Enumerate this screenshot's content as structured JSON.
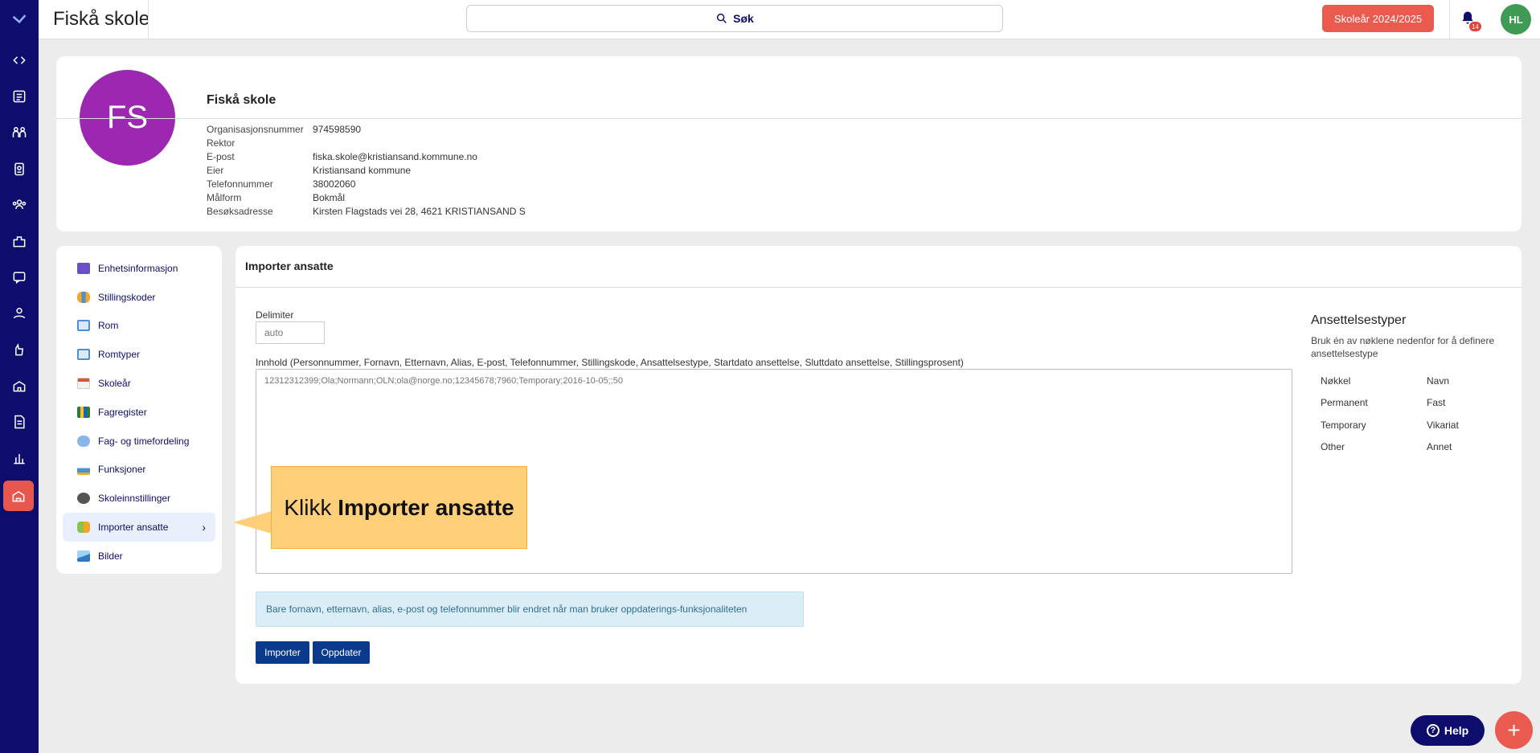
{
  "topbar": {
    "title": "Fiskå skole",
    "search_label": "Søk",
    "school_year": "Skoleår 2024/2025",
    "notification_count": "14",
    "user_initials": "HL"
  },
  "school": {
    "initials": "FS",
    "name": "Fiskå skole",
    "info": [
      {
        "label": "Organisasjonsnummer",
        "value": "974598590"
      },
      {
        "label": "Rektor",
        "value": ""
      },
      {
        "label": "E-post",
        "value": "fiska.skole@kristiansand.kommune.no"
      },
      {
        "label": "Eier",
        "value": "Kristiansand kommune"
      },
      {
        "label": "Telefonnummer",
        "value": "38002060"
      },
      {
        "label": "Målform",
        "value": "Bokmål"
      },
      {
        "label": "Besøksadresse",
        "value": "Kirsten Flagstads vei 28, 4621 KRISTIANSAND S"
      }
    ]
  },
  "menu": [
    {
      "label": "Enhetsinformasjon",
      "icon": "id-card-icon"
    },
    {
      "label": "Stillingskoder",
      "icon": "people-icon"
    },
    {
      "label": "Rom",
      "icon": "floorplan-icon"
    },
    {
      "label": "Romtyper",
      "icon": "floorplan-icon"
    },
    {
      "label": "Skoleår",
      "icon": "calendar-icon"
    },
    {
      "label": "Fagregister",
      "icon": "books-icon"
    },
    {
      "label": "Fag- og timefordeling",
      "icon": "schedule-icon"
    },
    {
      "label": "Funksjoner",
      "icon": "function-icon"
    },
    {
      "label": "Skoleinnstillinger",
      "icon": "gear-icon"
    },
    {
      "label": "Importer ansatte",
      "icon": "import-users-icon"
    },
    {
      "label": "Bilder",
      "icon": "image-icon"
    }
  ],
  "panel": {
    "title": "Importer ansatte",
    "delimiter_label": "Delimiter",
    "delimiter_placeholder": "auto",
    "content_label": "Innhold (Personnummer, Fornavn, Etternavn, Alias, E-post, Telefonnummer, Stillingskode, Ansattelsestype, Startdato ansettelse, Sluttdato ansettelse, Stillingsprosent)",
    "content_placeholder": "12312312399;Ola;Normann;OLN;ola@norge.no;12345678;7960;Temporary;2016-10-05;;50",
    "notice": "Bare fornavn, etternavn, alias, e-post og telefonnummer blir endret når man bruker oppdaterings-funksjonaliteten",
    "import_button": "Importer",
    "update_button": "Oppdater"
  },
  "types": {
    "title": "Ansettelsestyper",
    "description": "Bruk én av nøklene nedenfor for å definere ansettelsestype",
    "header_key": "Nøkkel",
    "header_name": "Navn",
    "rows": [
      {
        "key": "Permanent",
        "name": "Fast"
      },
      {
        "key": "Temporary",
        "name": "Vikariat"
      },
      {
        "key": "Other",
        "name": "Annet"
      }
    ]
  },
  "callout": {
    "prefix": "Klikk",
    "bold": "Importer ansatte"
  },
  "help_label": "Help",
  "colors": {
    "rail": "#0d0d6b",
    "accent": "#ea5a4f",
    "button_primary": "#0b3a8c",
    "avatar_school": "#9c27b0",
    "avatar_user": "#3f9b54",
    "callout": "#ffcf7a"
  }
}
